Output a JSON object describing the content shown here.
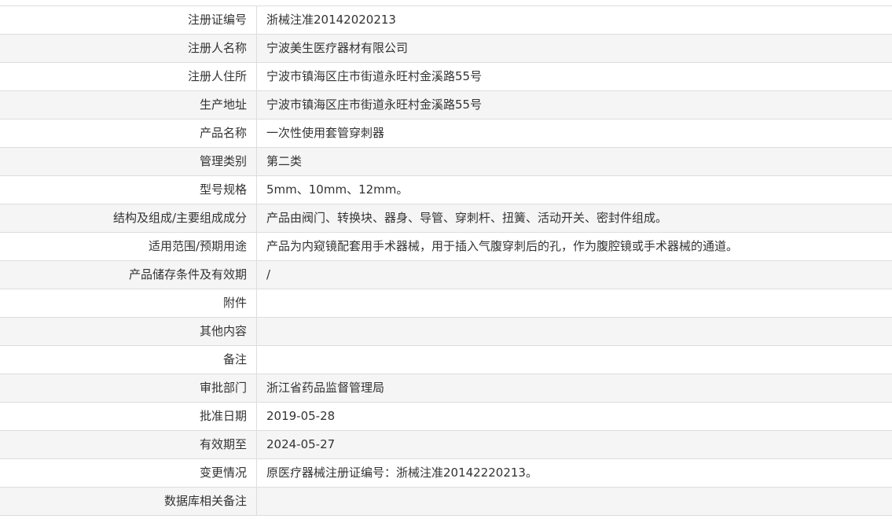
{
  "rows": [
    {
      "label": "注册证编号",
      "value": "浙械注准20142020213"
    },
    {
      "label": "注册人名称",
      "value": "宁波美生医疗器材有限公司"
    },
    {
      "label": "注册人住所",
      "value": "宁波市镇海区庄市街道永旺村金溪路55号"
    },
    {
      "label": "生产地址",
      "value": "宁波市镇海区庄市街道永旺村金溪路55号"
    },
    {
      "label": "产品名称",
      "value": "一次性使用套管穿刺器"
    },
    {
      "label": "管理类别",
      "value": "第二类"
    },
    {
      "label": "型号规格",
      "value": "5mm、10mm、12mm。"
    },
    {
      "label": "结构及组成/主要组成成分",
      "value": "产品由阀门、转换块、器身、导管、穿刺杆、扭簧、活动开关、密封件组成。"
    },
    {
      "label": "适用范围/预期用途",
      "value": "产品为内窥镜配套用手术器械，用于插入气腹穿刺后的孔，作为腹腔镜或手术器械的通道。"
    },
    {
      "label": "产品储存条件及有效期",
      "value": "/"
    },
    {
      "label": "附件",
      "value": ""
    },
    {
      "label": "其他内容",
      "value": ""
    },
    {
      "label": "备注",
      "value": ""
    },
    {
      "label": "审批部门",
      "value": "浙江省药品监督管理局"
    },
    {
      "label": "批准日期",
      "value": "2019-05-28"
    },
    {
      "label": "有效期至",
      "value": "2024-05-27"
    },
    {
      "label": "变更情况",
      "value": "原医疗器械注册证编号：浙械注准20142220213。"
    },
    {
      "label": "数据库相关备注",
      "value": ""
    }
  ]
}
